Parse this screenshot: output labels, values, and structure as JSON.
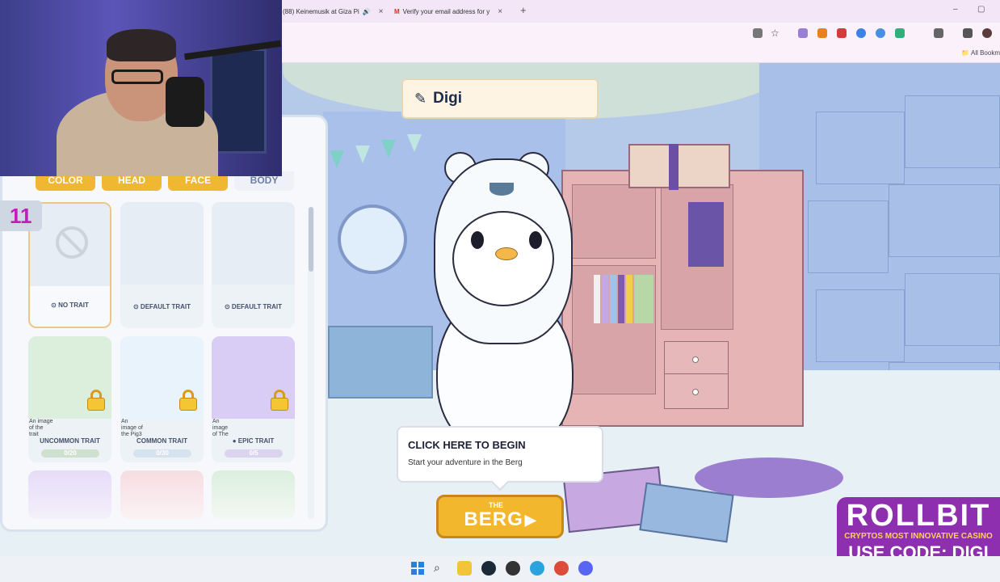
{
  "browser": {
    "tabs": [
      {
        "title": "(88) Keinemusik at Giza Pi",
        "close": "×"
      },
      {
        "title": "Verify your email address for y",
        "close": "×"
      }
    ],
    "new_tab": "+",
    "window_controls": [
      "–",
      "▢"
    ],
    "bookmarks_label": "All Bookm"
  },
  "webcam": {
    "description_label": ""
  },
  "counter": "11",
  "character": {
    "name": "Digi"
  },
  "trait_panel": {
    "categories": [
      "COLOR",
      "HEAD",
      "FACE",
      "BODY"
    ],
    "active_category": "BODY",
    "cards": [
      {
        "label": "NO TRAIT",
        "type": "none"
      },
      {
        "label": "DEFAULT TRAIT",
        "type": "default"
      },
      {
        "label": "DEFAULT TRAIT",
        "type": "default"
      },
      {
        "label": "UNCOMMON TRAIT",
        "count": "0/20",
        "locked": true,
        "color": "#dcefdc"
      },
      {
        "label": "COMMON TRAIT",
        "count": "0/30",
        "locked": true,
        "color": "#e9f3fb"
      },
      {
        "label": "EPIC TRAIT",
        "count": "0/5",
        "locked": true,
        "color": "#d9cdf6"
      }
    ],
    "alt_texts": [
      "An image of the trait",
      "An image of the Pig3",
      "An image of The"
    ]
  },
  "tooltip": {
    "title": "CLICK HERE TO BEGIN",
    "subtitle": "Start your adventure in the Berg"
  },
  "berg_button": {
    "the": "THE",
    "berg": "BERG",
    "arrow": "▶"
  },
  "rollbit": {
    "logo": "ROLLBIT",
    "tagline": "CRYPTOS MOST INNOVATIVE CASINO",
    "code": "USE CODE: DIGI"
  },
  "colors": {
    "accent_gold": "#f0b732",
    "counter_text": "#c51ac0",
    "rollbit_bg": "#8e2fb0"
  }
}
